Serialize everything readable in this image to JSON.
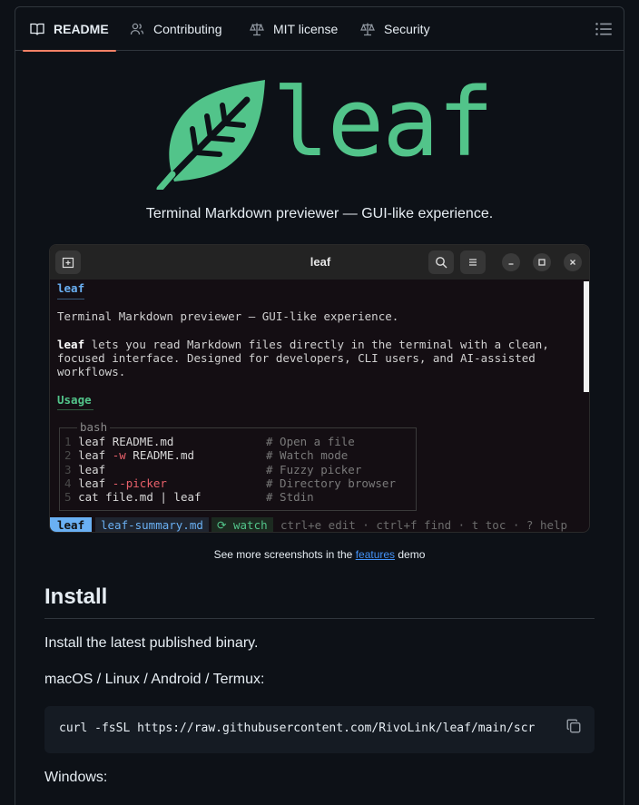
{
  "tabs": [
    {
      "label": "README",
      "icon": "book-icon",
      "active": true
    },
    {
      "label": "Contributing",
      "icon": "people-icon"
    },
    {
      "label": "MIT license",
      "icon": "scale-icon"
    },
    {
      "label": "Security",
      "icon": "scale-icon"
    }
  ],
  "outline_icon": "list-icon",
  "hero": {
    "wordmark": "leaf",
    "tagline": "Terminal Markdown previewer — GUI-like experience.",
    "logo_icon": "leaf-icon",
    "brand_color": "#52c48a"
  },
  "terminal": {
    "title": "leaf",
    "heading": "leaf",
    "intro": "Terminal Markdown previewer — GUI-like experience.",
    "desc_bold": "leaf",
    "desc_lines": [
      " lets you read Markdown files directly in the terminal with a clean,",
      "focused interface. Designed for developers, CLI users, and AI-assisted",
      "workflows."
    ],
    "usage_heading": "Usage",
    "code_lang": "bash",
    "code_lines": [
      {
        "n": "1",
        "cmd": "leaf README.md",
        "flag": "",
        "rest": "",
        "comment": "# Open a file"
      },
      {
        "n": "2",
        "cmd": "leaf ",
        "flag": "-w",
        "rest": " README.md",
        "comment": "# Watch mode"
      },
      {
        "n": "3",
        "cmd": "leaf",
        "flag": "",
        "rest": "",
        "comment": "# Fuzzy picker"
      },
      {
        "n": "4",
        "cmd": "leaf ",
        "flag": "--picker",
        "rest": "",
        "comment": "# Directory browser"
      },
      {
        "n": "5",
        "cmd": "cat file.md | leaf",
        "flag": "",
        "rest": "",
        "comment": "# Stdin"
      }
    ],
    "status": {
      "app": "leaf",
      "file": "leaf-summary.md",
      "watch": "⟳ watch",
      "hints": "ctrl+e edit · ctrl+f find · t toc · ? help"
    }
  },
  "caption": {
    "before": "See more screenshots in the ",
    "link": "features",
    "after": " demo"
  },
  "install": {
    "heading": "Install",
    "intro": "Install the latest published binary.",
    "platforms": "macOS / Linux / Android / Termux:",
    "command": "curl -fsSL https://raw.githubusercontent.com/RivoLink/leaf/main/scr",
    "windows": "Windows:"
  }
}
